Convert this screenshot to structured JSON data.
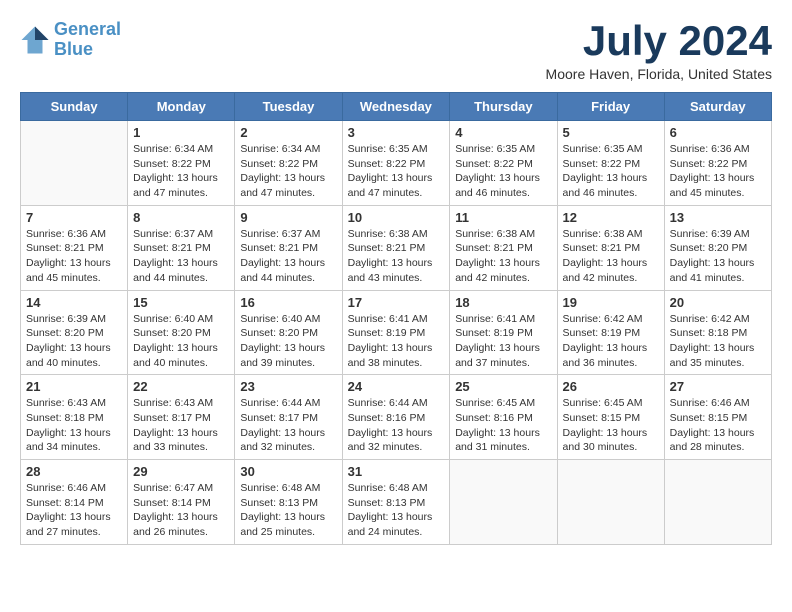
{
  "logo": {
    "line1": "General",
    "line2": "Blue"
  },
  "title": "July 2024",
  "location": "Moore Haven, Florida, United States",
  "days_of_week": [
    "Sunday",
    "Monday",
    "Tuesday",
    "Wednesday",
    "Thursday",
    "Friday",
    "Saturday"
  ],
  "weeks": [
    [
      {
        "day": "",
        "info": ""
      },
      {
        "day": "1",
        "info": "Sunrise: 6:34 AM\nSunset: 8:22 PM\nDaylight: 13 hours\nand 47 minutes."
      },
      {
        "day": "2",
        "info": "Sunrise: 6:34 AM\nSunset: 8:22 PM\nDaylight: 13 hours\nand 47 minutes."
      },
      {
        "day": "3",
        "info": "Sunrise: 6:35 AM\nSunset: 8:22 PM\nDaylight: 13 hours\nand 47 minutes."
      },
      {
        "day": "4",
        "info": "Sunrise: 6:35 AM\nSunset: 8:22 PM\nDaylight: 13 hours\nand 46 minutes."
      },
      {
        "day": "5",
        "info": "Sunrise: 6:35 AM\nSunset: 8:22 PM\nDaylight: 13 hours\nand 46 minutes."
      },
      {
        "day": "6",
        "info": "Sunrise: 6:36 AM\nSunset: 8:22 PM\nDaylight: 13 hours\nand 45 minutes."
      }
    ],
    [
      {
        "day": "7",
        "info": "Sunrise: 6:36 AM\nSunset: 8:21 PM\nDaylight: 13 hours\nand 45 minutes."
      },
      {
        "day": "8",
        "info": "Sunrise: 6:37 AM\nSunset: 8:21 PM\nDaylight: 13 hours\nand 44 minutes."
      },
      {
        "day": "9",
        "info": "Sunrise: 6:37 AM\nSunset: 8:21 PM\nDaylight: 13 hours\nand 44 minutes."
      },
      {
        "day": "10",
        "info": "Sunrise: 6:38 AM\nSunset: 8:21 PM\nDaylight: 13 hours\nand 43 minutes."
      },
      {
        "day": "11",
        "info": "Sunrise: 6:38 AM\nSunset: 8:21 PM\nDaylight: 13 hours\nand 42 minutes."
      },
      {
        "day": "12",
        "info": "Sunrise: 6:38 AM\nSunset: 8:21 PM\nDaylight: 13 hours\nand 42 minutes."
      },
      {
        "day": "13",
        "info": "Sunrise: 6:39 AM\nSunset: 8:20 PM\nDaylight: 13 hours\nand 41 minutes."
      }
    ],
    [
      {
        "day": "14",
        "info": "Sunrise: 6:39 AM\nSunset: 8:20 PM\nDaylight: 13 hours\nand 40 minutes."
      },
      {
        "day": "15",
        "info": "Sunrise: 6:40 AM\nSunset: 8:20 PM\nDaylight: 13 hours\nand 40 minutes."
      },
      {
        "day": "16",
        "info": "Sunrise: 6:40 AM\nSunset: 8:20 PM\nDaylight: 13 hours\nand 39 minutes."
      },
      {
        "day": "17",
        "info": "Sunrise: 6:41 AM\nSunset: 8:19 PM\nDaylight: 13 hours\nand 38 minutes."
      },
      {
        "day": "18",
        "info": "Sunrise: 6:41 AM\nSunset: 8:19 PM\nDaylight: 13 hours\nand 37 minutes."
      },
      {
        "day": "19",
        "info": "Sunrise: 6:42 AM\nSunset: 8:19 PM\nDaylight: 13 hours\nand 36 minutes."
      },
      {
        "day": "20",
        "info": "Sunrise: 6:42 AM\nSunset: 8:18 PM\nDaylight: 13 hours\nand 35 minutes."
      }
    ],
    [
      {
        "day": "21",
        "info": "Sunrise: 6:43 AM\nSunset: 8:18 PM\nDaylight: 13 hours\nand 34 minutes."
      },
      {
        "day": "22",
        "info": "Sunrise: 6:43 AM\nSunset: 8:17 PM\nDaylight: 13 hours\nand 33 minutes."
      },
      {
        "day": "23",
        "info": "Sunrise: 6:44 AM\nSunset: 8:17 PM\nDaylight: 13 hours\nand 32 minutes."
      },
      {
        "day": "24",
        "info": "Sunrise: 6:44 AM\nSunset: 8:16 PM\nDaylight: 13 hours\nand 32 minutes."
      },
      {
        "day": "25",
        "info": "Sunrise: 6:45 AM\nSunset: 8:16 PM\nDaylight: 13 hours\nand 31 minutes."
      },
      {
        "day": "26",
        "info": "Sunrise: 6:45 AM\nSunset: 8:15 PM\nDaylight: 13 hours\nand 30 minutes."
      },
      {
        "day": "27",
        "info": "Sunrise: 6:46 AM\nSunset: 8:15 PM\nDaylight: 13 hours\nand 28 minutes."
      }
    ],
    [
      {
        "day": "28",
        "info": "Sunrise: 6:46 AM\nSunset: 8:14 PM\nDaylight: 13 hours\nand 27 minutes."
      },
      {
        "day": "29",
        "info": "Sunrise: 6:47 AM\nSunset: 8:14 PM\nDaylight: 13 hours\nand 26 minutes."
      },
      {
        "day": "30",
        "info": "Sunrise: 6:48 AM\nSunset: 8:13 PM\nDaylight: 13 hours\nand 25 minutes."
      },
      {
        "day": "31",
        "info": "Sunrise: 6:48 AM\nSunset: 8:13 PM\nDaylight: 13 hours\nand 24 minutes."
      },
      {
        "day": "",
        "info": ""
      },
      {
        "day": "",
        "info": ""
      },
      {
        "day": "",
        "info": ""
      }
    ]
  ]
}
